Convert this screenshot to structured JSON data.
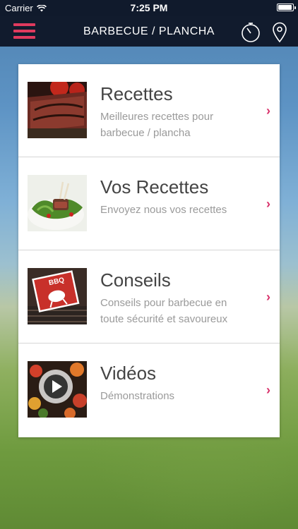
{
  "status_bar": {
    "carrier": "Carrier",
    "time": "7:25 PM",
    "battery_level": 0.95
  },
  "nav": {
    "title": "BARBECUE / PLANCHA",
    "menu_icon": "hamburger-menu-icon",
    "timer_icon": "timer-icon",
    "location_icon": "map-pin-icon",
    "accent_color": "#e03a5e"
  },
  "menu": [
    {
      "title": "Recettes",
      "subtitle": "Meilleures recettes pour barbecue / plancha",
      "image": "grilled-steak-photo"
    },
    {
      "title": "Vos Recettes",
      "subtitle": "Envoyez nous vos recettes",
      "image": "lamb-chops-salad-photo"
    },
    {
      "title": "Conseils",
      "subtitle": "Conseils pour barbecue en toute sécurité et savoureux",
      "image": "bbq-sign-photo"
    },
    {
      "title": "Vidéos",
      "subtitle": "Démonstrations",
      "image": "grilled-vegetables-video-photo"
    }
  ],
  "chevron": "›",
  "chevron_color": "#d8306a",
  "bbq_sign_text": "BBQ"
}
